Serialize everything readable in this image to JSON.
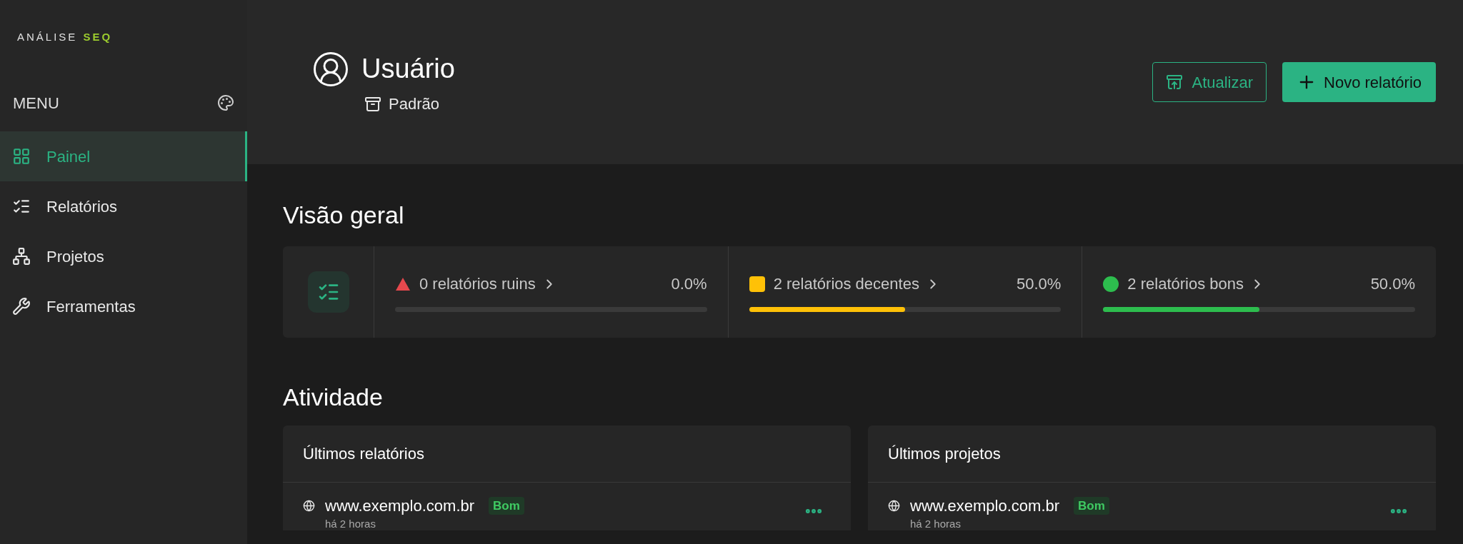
{
  "logo": {
    "part_1": "ANÁLISE",
    "part_2": "SEQ"
  },
  "sidebar": {
    "heading": "MENU",
    "items": [
      {
        "label": "Painel",
        "selected": true
      },
      {
        "label": "Relatórios",
        "selected": false
      },
      {
        "label": "Projetos",
        "selected": false
      },
      {
        "label": "Ferramentas",
        "selected": false
      }
    ]
  },
  "header": {
    "user_name": "Usuário",
    "plan": "Padrão",
    "buttons": [
      {
        "label": "Atualizar",
        "kind": "outline"
      },
      {
        "label": "Novo relatório",
        "kind": "primary"
      }
    ]
  },
  "overview": {
    "title": "Visão geral",
    "stats": [
      {
        "label": "0 relatórios ruins",
        "percent": "0.0%",
        "level": 0,
        "color": "#e5484d",
        "kind": "triangle"
      },
      {
        "label": "2 relatórios decentes",
        "percent": "50.0%",
        "level": 0.5,
        "color": "#ffc107",
        "kind": "square"
      },
      {
        "label": "2 relatórios bons",
        "percent": "50.0%",
        "level": 0.5,
        "color": "#2dbd4e",
        "kind": "circle"
      }
    ]
  },
  "activity": {
    "title": "Atividade",
    "panels": [
      {
        "title": "Últimos relatórios",
        "rows": [
          {
            "url": "www.exemplo.com.br",
            "badge": "Bom",
            "time": "há 2 horas"
          }
        ]
      },
      {
        "title": "Últimos projetos",
        "rows": [
          {
            "url": "www.exemplo.com.br",
            "badge": "Bom",
            "time": "há 2 horas"
          }
        ]
      }
    ]
  }
}
